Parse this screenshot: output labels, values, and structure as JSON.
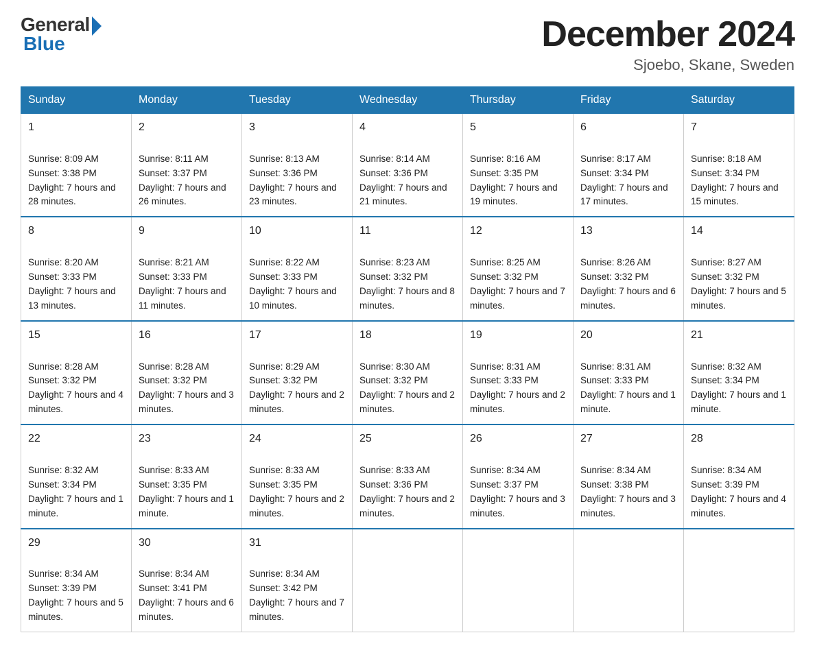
{
  "logo": {
    "general_text": "General",
    "blue_text": "Blue"
  },
  "title": {
    "month_year": "December 2024",
    "location": "Sjoebo, Skane, Sweden"
  },
  "days_of_week": [
    "Sunday",
    "Monday",
    "Tuesday",
    "Wednesday",
    "Thursday",
    "Friday",
    "Saturday"
  ],
  "weeks": [
    [
      {
        "day": "1",
        "sunrise": "Sunrise: 8:09 AM",
        "sunset": "Sunset: 3:38 PM",
        "daylight": "Daylight: 7 hours and 28 minutes."
      },
      {
        "day": "2",
        "sunrise": "Sunrise: 8:11 AM",
        "sunset": "Sunset: 3:37 PM",
        "daylight": "Daylight: 7 hours and 26 minutes."
      },
      {
        "day": "3",
        "sunrise": "Sunrise: 8:13 AM",
        "sunset": "Sunset: 3:36 PM",
        "daylight": "Daylight: 7 hours and 23 minutes."
      },
      {
        "day": "4",
        "sunrise": "Sunrise: 8:14 AM",
        "sunset": "Sunset: 3:36 PM",
        "daylight": "Daylight: 7 hours and 21 minutes."
      },
      {
        "day": "5",
        "sunrise": "Sunrise: 8:16 AM",
        "sunset": "Sunset: 3:35 PM",
        "daylight": "Daylight: 7 hours and 19 minutes."
      },
      {
        "day": "6",
        "sunrise": "Sunrise: 8:17 AM",
        "sunset": "Sunset: 3:34 PM",
        "daylight": "Daylight: 7 hours and 17 minutes."
      },
      {
        "day": "7",
        "sunrise": "Sunrise: 8:18 AM",
        "sunset": "Sunset: 3:34 PM",
        "daylight": "Daylight: 7 hours and 15 minutes."
      }
    ],
    [
      {
        "day": "8",
        "sunrise": "Sunrise: 8:20 AM",
        "sunset": "Sunset: 3:33 PM",
        "daylight": "Daylight: 7 hours and 13 minutes."
      },
      {
        "day": "9",
        "sunrise": "Sunrise: 8:21 AM",
        "sunset": "Sunset: 3:33 PM",
        "daylight": "Daylight: 7 hours and 11 minutes."
      },
      {
        "day": "10",
        "sunrise": "Sunrise: 8:22 AM",
        "sunset": "Sunset: 3:33 PM",
        "daylight": "Daylight: 7 hours and 10 minutes."
      },
      {
        "day": "11",
        "sunrise": "Sunrise: 8:23 AM",
        "sunset": "Sunset: 3:32 PM",
        "daylight": "Daylight: 7 hours and 8 minutes."
      },
      {
        "day": "12",
        "sunrise": "Sunrise: 8:25 AM",
        "sunset": "Sunset: 3:32 PM",
        "daylight": "Daylight: 7 hours and 7 minutes."
      },
      {
        "day": "13",
        "sunrise": "Sunrise: 8:26 AM",
        "sunset": "Sunset: 3:32 PM",
        "daylight": "Daylight: 7 hours and 6 minutes."
      },
      {
        "day": "14",
        "sunrise": "Sunrise: 8:27 AM",
        "sunset": "Sunset: 3:32 PM",
        "daylight": "Daylight: 7 hours and 5 minutes."
      }
    ],
    [
      {
        "day": "15",
        "sunrise": "Sunrise: 8:28 AM",
        "sunset": "Sunset: 3:32 PM",
        "daylight": "Daylight: 7 hours and 4 minutes."
      },
      {
        "day": "16",
        "sunrise": "Sunrise: 8:28 AM",
        "sunset": "Sunset: 3:32 PM",
        "daylight": "Daylight: 7 hours and 3 minutes."
      },
      {
        "day": "17",
        "sunrise": "Sunrise: 8:29 AM",
        "sunset": "Sunset: 3:32 PM",
        "daylight": "Daylight: 7 hours and 2 minutes."
      },
      {
        "day": "18",
        "sunrise": "Sunrise: 8:30 AM",
        "sunset": "Sunset: 3:32 PM",
        "daylight": "Daylight: 7 hours and 2 minutes."
      },
      {
        "day": "19",
        "sunrise": "Sunrise: 8:31 AM",
        "sunset": "Sunset: 3:33 PM",
        "daylight": "Daylight: 7 hours and 2 minutes."
      },
      {
        "day": "20",
        "sunrise": "Sunrise: 8:31 AM",
        "sunset": "Sunset: 3:33 PM",
        "daylight": "Daylight: 7 hours and 1 minute."
      },
      {
        "day": "21",
        "sunrise": "Sunrise: 8:32 AM",
        "sunset": "Sunset: 3:34 PM",
        "daylight": "Daylight: 7 hours and 1 minute."
      }
    ],
    [
      {
        "day": "22",
        "sunrise": "Sunrise: 8:32 AM",
        "sunset": "Sunset: 3:34 PM",
        "daylight": "Daylight: 7 hours and 1 minute."
      },
      {
        "day": "23",
        "sunrise": "Sunrise: 8:33 AM",
        "sunset": "Sunset: 3:35 PM",
        "daylight": "Daylight: 7 hours and 1 minute."
      },
      {
        "day": "24",
        "sunrise": "Sunrise: 8:33 AM",
        "sunset": "Sunset: 3:35 PM",
        "daylight": "Daylight: 7 hours and 2 minutes."
      },
      {
        "day": "25",
        "sunrise": "Sunrise: 8:33 AM",
        "sunset": "Sunset: 3:36 PM",
        "daylight": "Daylight: 7 hours and 2 minutes."
      },
      {
        "day": "26",
        "sunrise": "Sunrise: 8:34 AM",
        "sunset": "Sunset: 3:37 PM",
        "daylight": "Daylight: 7 hours and 3 minutes."
      },
      {
        "day": "27",
        "sunrise": "Sunrise: 8:34 AM",
        "sunset": "Sunset: 3:38 PM",
        "daylight": "Daylight: 7 hours and 3 minutes."
      },
      {
        "day": "28",
        "sunrise": "Sunrise: 8:34 AM",
        "sunset": "Sunset: 3:39 PM",
        "daylight": "Daylight: 7 hours and 4 minutes."
      }
    ],
    [
      {
        "day": "29",
        "sunrise": "Sunrise: 8:34 AM",
        "sunset": "Sunset: 3:39 PM",
        "daylight": "Daylight: 7 hours and 5 minutes."
      },
      {
        "day": "30",
        "sunrise": "Sunrise: 8:34 AM",
        "sunset": "Sunset: 3:41 PM",
        "daylight": "Daylight: 7 hours and 6 minutes."
      },
      {
        "day": "31",
        "sunrise": "Sunrise: 8:34 AM",
        "sunset": "Sunset: 3:42 PM",
        "daylight": "Daylight: 7 hours and 7 minutes."
      },
      null,
      null,
      null,
      null
    ]
  ]
}
